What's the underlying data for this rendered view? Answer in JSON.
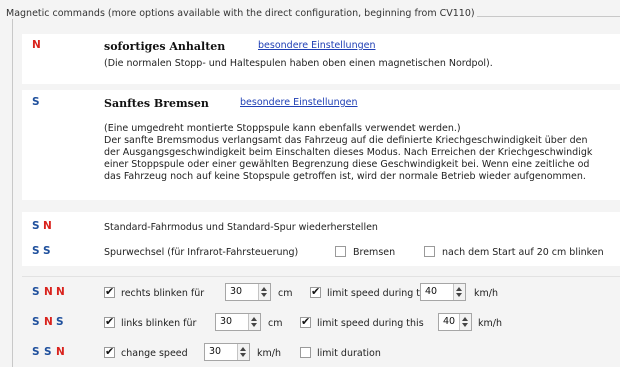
{
  "group_title": "Magnetic commands (more options available with the direct configuration, beginning from CV110)",
  "row1": {
    "code": "N",
    "title": "sofortiges Anhalten",
    "link": "besondere Einstellungen",
    "desc": "(Die normalen Stopp- und Haltespulen haben oben einen magnetischen Nordpol)."
  },
  "row2": {
    "code": "S",
    "title": "Sanftes Bremsen",
    "link": "besondere Einstellungen",
    "desc": [
      "(Eine umgedreht montierte Stoppspule kann ebenfalls verwendet werden.)",
      "Der sanfte Bremsmodus verlangsamt das Fahrzeug auf die definierte Kriechgeschwindigkeit über den",
      "der Ausgangsgeschwindigkeit beim Einschalten dieses Modus. Nach Erreichen der Kriechgeschwindigk",
      "einer Stoppspule oder einer gewählten Begrenzung diese Geschwindigkeit bei. Wenn eine zeitliche od",
      "das Fahrzeug noch auf keine Stopspule getroffen ist, wird der normale Betrieb wieder aufgenommen."
    ]
  },
  "row3": {
    "code_s": "S",
    "code_n": "N",
    "text": "Standard-Fahrmodus und Standard-Spur wiederherstellen"
  },
  "row4": {
    "code_a": "S",
    "code_b": "S",
    "text": "Spurwechsel (für Infrarot-Fahrsteuerung)",
    "cb1_label": "Bremsen",
    "cb1_checked": false,
    "cb2_label": "nach dem Start auf 20 cm blinken",
    "cb2_checked": false
  },
  "row5": {
    "code_a": "S",
    "code_b": "N",
    "code_c": "N",
    "cb1_label": "rechts blinken für",
    "cb1_checked": true,
    "value1": "30",
    "unit1": "cm",
    "cb2_label": "limit speed during this",
    "cb2_checked": true,
    "value2": "40",
    "unit2": "km/h"
  },
  "row6": {
    "code_a": "S",
    "code_b": "N",
    "code_c": "S",
    "cb1_label": "links blinken für",
    "cb1_checked": true,
    "value1": "30",
    "unit1": "cm",
    "cb2_label": "limit speed during this",
    "cb2_checked": true,
    "value2": "40",
    "unit2": "km/h"
  },
  "row7": {
    "code_a": "S",
    "code_b": "S",
    "code_c": "N",
    "cb1_label": "change speed",
    "cb1_checked": true,
    "value1": "30",
    "unit1": "km/h",
    "cb2_label": "limit duration",
    "cb2_checked": false
  },
  "colors": {
    "red": "#d9231d",
    "blue": "#1e4f9c",
    "link": "#1f3fb4"
  }
}
